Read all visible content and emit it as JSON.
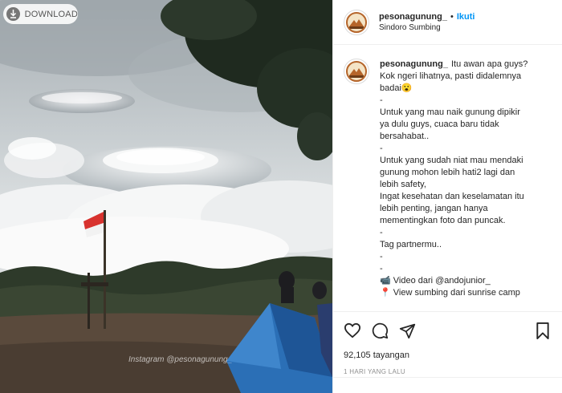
{
  "media": {
    "download_label": "DOWNLOAD",
    "watermark": "Instagram @pesonagunung_"
  },
  "post": {
    "username": "pesonagunung_",
    "separator": "•",
    "follow_label": "Ikuti",
    "location": "Sindoro Sumbing"
  },
  "caption": {
    "username": "pesonagunung_",
    "lines": [
      "Itu awan apa guys?",
      "Kok ngeri lihatnya, pasti didalemnya",
      "badai😮",
      "-",
      "Untuk yang mau naik gunung dipikir",
      "ya dulu guys, cuaca baru tidak",
      "bersahabat..",
      "-",
      "Untuk yang sudah niat mau mendaki",
      "gunung mohon lebih hati2 lagi dan",
      "lebih safety,",
      "Ingat kesehatan dan keselamatan itu",
      "lebih penting, jangan hanya",
      "mementingkan foto dan puncak.",
      "-",
      "Tag partnermu..",
      "-",
      "-",
      "📹 Video dari @andojunior_",
      "📍 View sumbing dari sunrise camp"
    ]
  },
  "stats": {
    "views": "92,105 tayangan",
    "time": "1 HARI YANG LALU"
  },
  "icons": {
    "like": "heart-icon",
    "comment": "comment-icon",
    "share": "share-icon",
    "save": "bookmark-icon",
    "download": "download-icon"
  },
  "colors": {
    "follow": "#0095f6",
    "text": "#262626",
    "muted": "#8e8e8e",
    "border": "#efefef"
  }
}
